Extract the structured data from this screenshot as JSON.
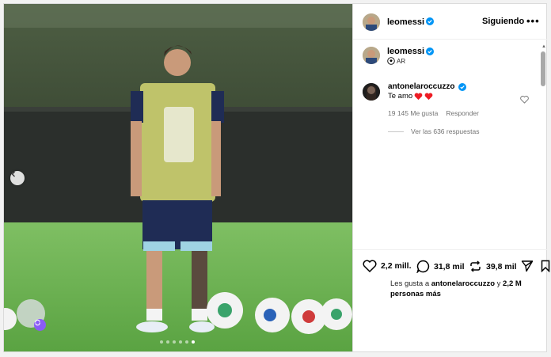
{
  "post": {
    "author": "leomessi",
    "follow_label": "Siguiendo",
    "more_label": "•••",
    "location": "AR",
    "carousel": {
      "slides": 6,
      "active_index": 5
    }
  },
  "comments": [
    {
      "username": "antonelaroccuzzo",
      "text": "Te amo",
      "likes": "19 145 Me gusta",
      "reply_label": "Responder",
      "replies_label": "Ver las 636 respuestas"
    }
  ],
  "actions": {
    "likes": "2,2 mill.",
    "comments": "31,8 mil",
    "reposts": "39,8 mil"
  },
  "liked_by": {
    "prefix": "Les gusta a",
    "user": "antonelaroccuzzo",
    "conj": "y",
    "others": "2,2 M",
    "suffix": "personas más"
  },
  "colors": {
    "verified": "#0095f6",
    "heart": "#ed1c24"
  }
}
